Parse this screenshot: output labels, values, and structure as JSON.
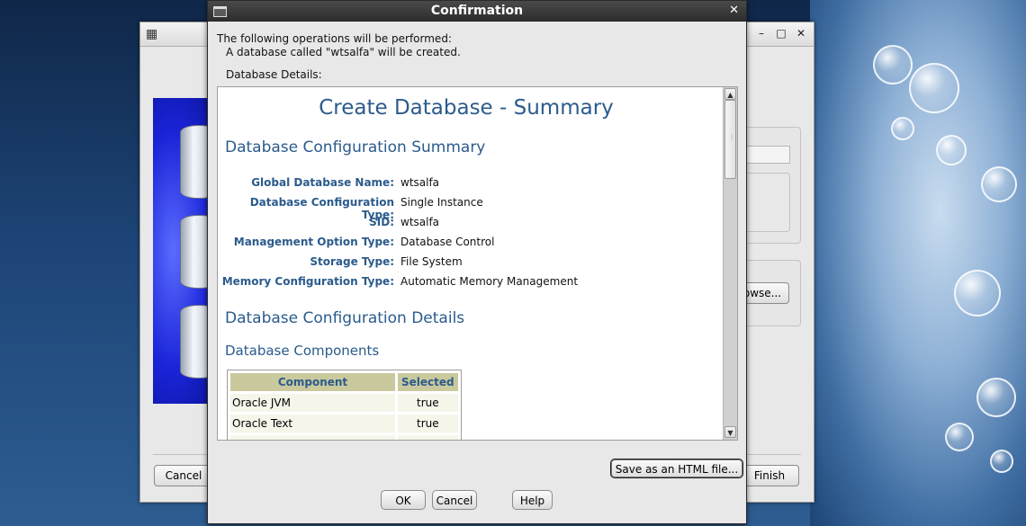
{
  "background_window": {
    "cancel_label": "Cancel",
    "finish_label": "Finish",
    "browse_label": "owse..."
  },
  "dialog": {
    "title": "Confirmation",
    "intro_line": "The following operations will be performed:",
    "operation_line": "A database called \"wtsalfa\" will be created.",
    "details_label": "Database Details:",
    "summary": {
      "title": "Create Database - Summary",
      "config_summary_heading": "Database Configuration Summary",
      "rows": [
        {
          "label": "Global Database Name:",
          "value": "wtsalfa"
        },
        {
          "label": "Database Configuration Type:",
          "value": "Single Instance"
        },
        {
          "label": "SID:",
          "value": "wtsalfa"
        },
        {
          "label": "Management Option Type:",
          "value": "Database Control"
        },
        {
          "label": "Storage Type:",
          "value": "File System"
        },
        {
          "label": "Memory Configuration Type:",
          "value": "Automatic Memory Management"
        }
      ],
      "config_details_heading": "Database Configuration Details",
      "components_heading": "Database Components",
      "components_table": {
        "headers": [
          "Component",
          "Selected"
        ],
        "rows": [
          [
            "Oracle JVM",
            "true"
          ],
          [
            "Oracle Text",
            "true"
          ]
        ]
      }
    },
    "save_html_label": "Save as an HTML file...",
    "ok_label": "OK",
    "cancel_label": "Cancel",
    "help_label": "Help"
  }
}
